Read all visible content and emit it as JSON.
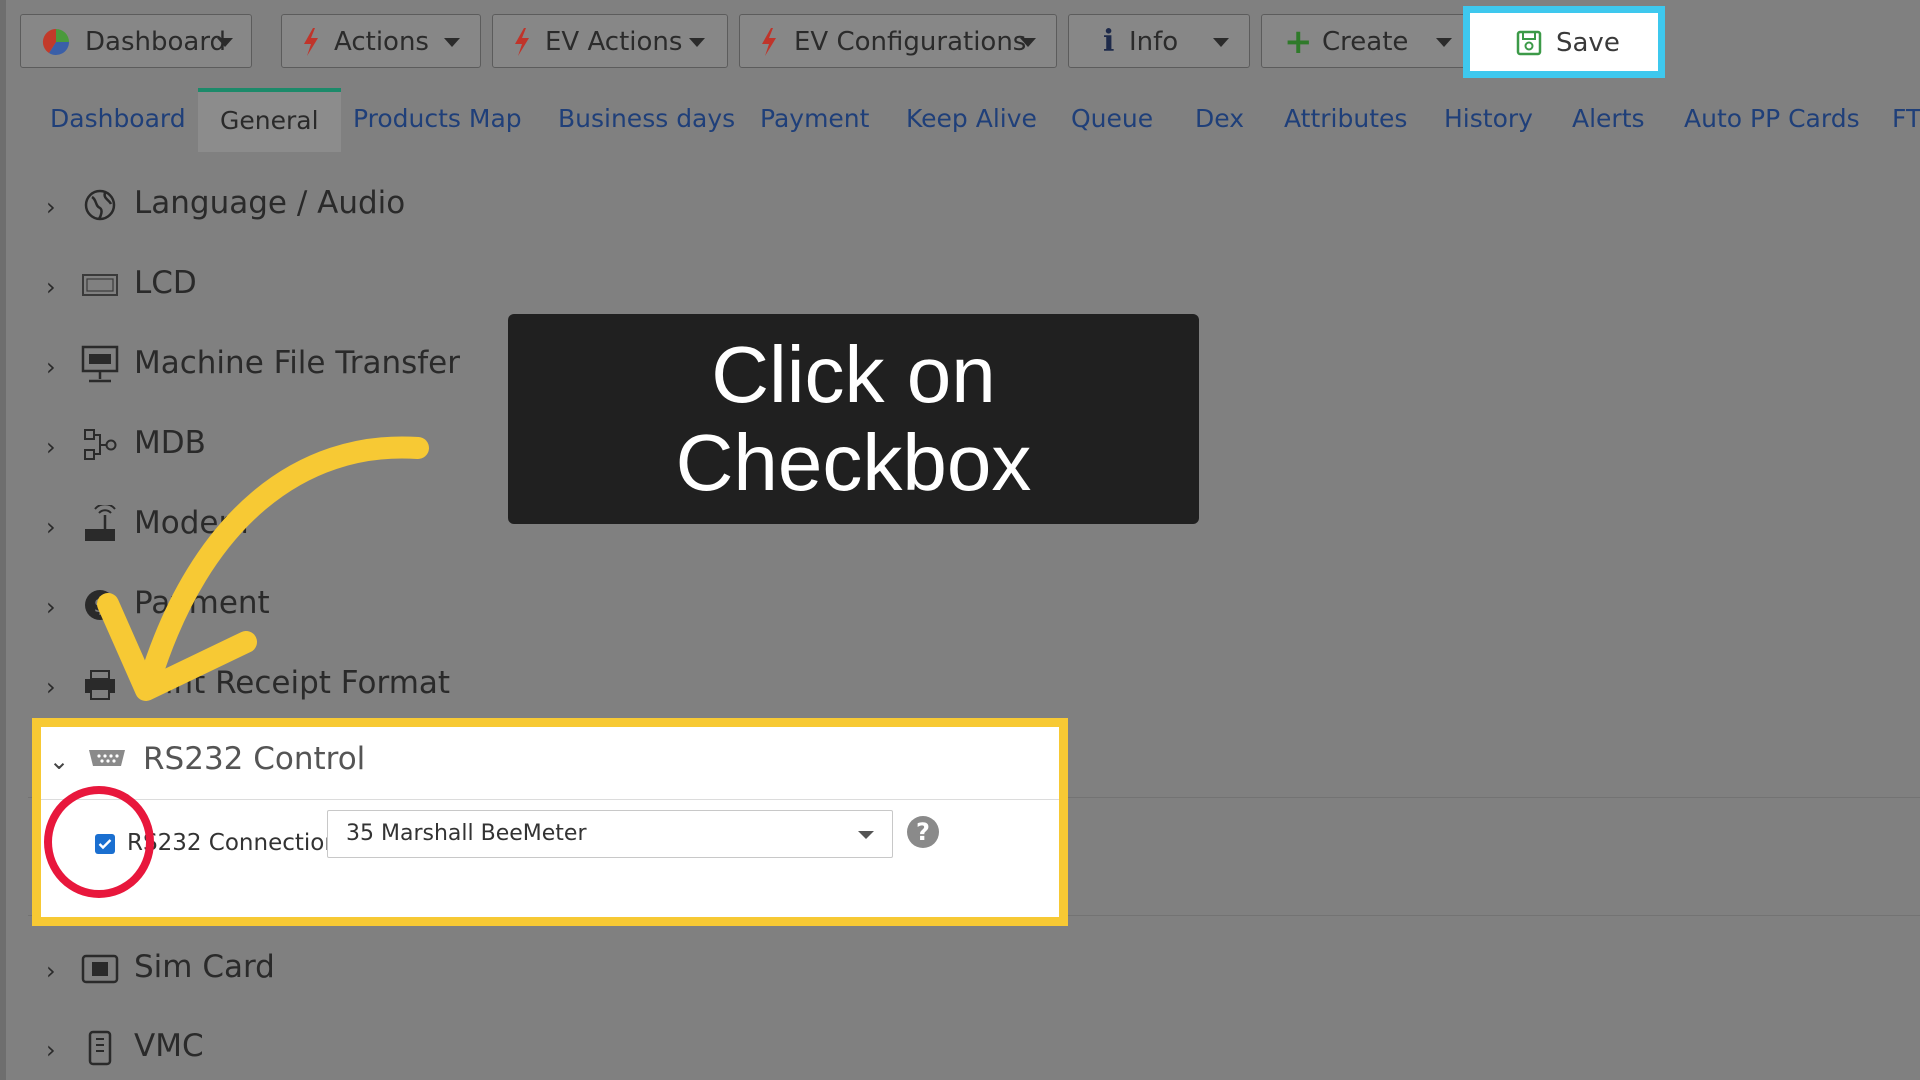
{
  "toolbar": {
    "buttons": [
      {
        "label": "Dashboard",
        "icon": "pie-chart-icon"
      },
      {
        "label": "Actions",
        "icon": "bolt-icon"
      },
      {
        "label": "EV Actions",
        "icon": "bolt-icon"
      },
      {
        "label": "EV Configurations",
        "icon": "bolt-icon"
      },
      {
        "label": "Info",
        "icon": "info-icon"
      },
      {
        "label": "Create",
        "icon": "plus-icon"
      }
    ],
    "save_label": "Save"
  },
  "tabs": [
    "Dashboard",
    "General",
    "Products Map",
    "Business days",
    "Payment",
    "Keep Alive",
    "Queue",
    "Dex",
    "Attributes",
    "History",
    "Alerts",
    "Auto PP Cards",
    "FT"
  ],
  "active_tab": "General",
  "sections": [
    {
      "label": "Language / Audio",
      "icon": "globe-icon"
    },
    {
      "label": "LCD",
      "icon": "lcd-icon"
    },
    {
      "label": "Machine File Transfer",
      "icon": "ftp-icon"
    },
    {
      "label": "MDB",
      "icon": "mdb-icon"
    },
    {
      "label": "Modem",
      "icon": "modem-icon"
    },
    {
      "label": "Payment",
      "icon": "payment-icon"
    },
    {
      "label": "Print Receipt Format",
      "icon": "printer-icon"
    },
    {
      "label": "Sim Card",
      "icon": "sim-card-icon"
    },
    {
      "label": "VMC",
      "icon": "vmc-icon"
    }
  ],
  "rs232": {
    "title": "RS232 Control",
    "checkbox_label": "RS232 Connection",
    "checked": true,
    "select_value": "35 Marshall BeeMeter",
    "help": "?"
  },
  "callout": {
    "line1": "Click on",
    "line2": "Checkbox"
  },
  "colors": {
    "save_highlight": "#3ec8ee",
    "panel_highlight": "#f7c934",
    "circle": "#e8173c",
    "arrow": "#f7c934",
    "tab_text": "#1f3f79",
    "callout_bg": "#202020"
  }
}
